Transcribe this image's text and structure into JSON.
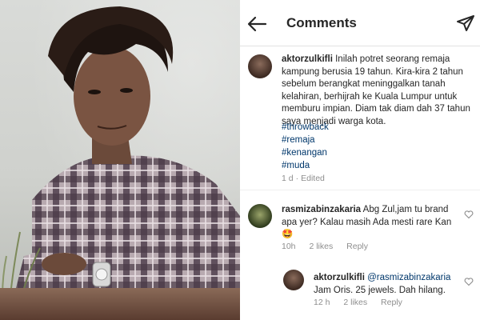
{
  "header": {
    "title": "Comments"
  },
  "caption": {
    "username": "aktorzulkifli",
    "text": "Inilah potret seorang remaja kampung berusia 19 tahun. Kira-kira 2 tahun sebelum berangkat meninggalkan tanah kelahiran, berhijrah ke Kuala Lumpur untuk memburu impian. Diam tak diam dah 37 tahun saya menjadi warga kota.",
    "hashtags": [
      "#throwback",
      "#remaja",
      "#kenangan",
      "#muda"
    ],
    "time": "1 d",
    "edited": "Edited"
  },
  "comments": [
    {
      "username": "rasmizabinzakaria",
      "text": "Abg Zul,jam tu brand apa yer? Kalau masih Ada mesti rare Kan🤩",
      "time": "10h",
      "likes": "2 likes",
      "reply": "Reply"
    },
    {
      "username": "aktorzulkifli",
      "mention": "@rasmizabinzakaria",
      "text": "Jam Oris. 25 jewels. Dah hilang.",
      "time": "12 h",
      "likes": "2 likes",
      "reply": "Reply"
    }
  ],
  "icons": {
    "back": "arrow-left-icon",
    "send": "paper-plane-icon",
    "like": "heart-icon"
  },
  "colors": {
    "link": "#00376b",
    "meta": "#8e8e8e",
    "text": "#262626"
  }
}
